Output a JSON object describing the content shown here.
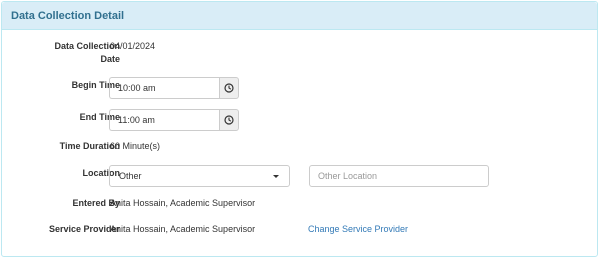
{
  "panel": {
    "title": "Data Collection Detail"
  },
  "fields": {
    "date": {
      "label": "Data Collection Date",
      "label_line1": "Data Collection",
      "label_line2": "Date",
      "value": "04/01/2024"
    },
    "begin_time": {
      "label": "Begin Time",
      "value": "10:00 am"
    },
    "end_time": {
      "label": "End Time",
      "value": "11:00 am"
    },
    "duration": {
      "label": "Time Duration",
      "value": "60 Minute(s)"
    },
    "location": {
      "label": "Location",
      "selected": "Other",
      "other_placeholder": "Other Location"
    },
    "entered_by": {
      "label": "Entered By",
      "value": "Anita Hossain, Academic Supervisor"
    },
    "service_provider": {
      "label": "Service Provider",
      "value": "Anita Hossain, Academic Supervisor",
      "change_link": "Change Service Provider"
    }
  },
  "icons": {
    "time_addon": "clock-icon",
    "select_caret": "caret-down-icon"
  },
  "colors": {
    "heading_bg": "#d9edf7",
    "heading_text": "#31708f",
    "border": "#bce8f1",
    "link": "#337ab7"
  }
}
